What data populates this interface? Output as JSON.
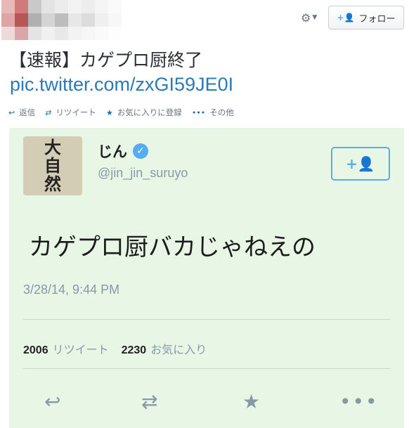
{
  "header": {
    "follow_label": "フォロー"
  },
  "tweet": {
    "text": "【速報】カゲプロ厨終了",
    "link": "pic.twitter.com/zxGI59JE0I",
    "actions": [
      {
        "label": "返信",
        "icon": "reply-icon"
      },
      {
        "label": "リツイート",
        "icon": "retweet-icon"
      },
      {
        "label": "お気に入りに登録",
        "icon": "star-icon"
      },
      {
        "label": "その他",
        "icon": "more-icon"
      }
    ]
  },
  "embedded": {
    "avatar_text": [
      "大",
      "自",
      "然"
    ],
    "name": "じん",
    "handle": "@jin_jin_suruyo",
    "text": "カゲプロ厨バカじゃねえの",
    "timestamp": "3/28/14, 9:44 PM",
    "retweet_count": "2006",
    "retweet_label": "リツイート",
    "favorite_count": "2230",
    "favorite_label": "お気に入り"
  }
}
